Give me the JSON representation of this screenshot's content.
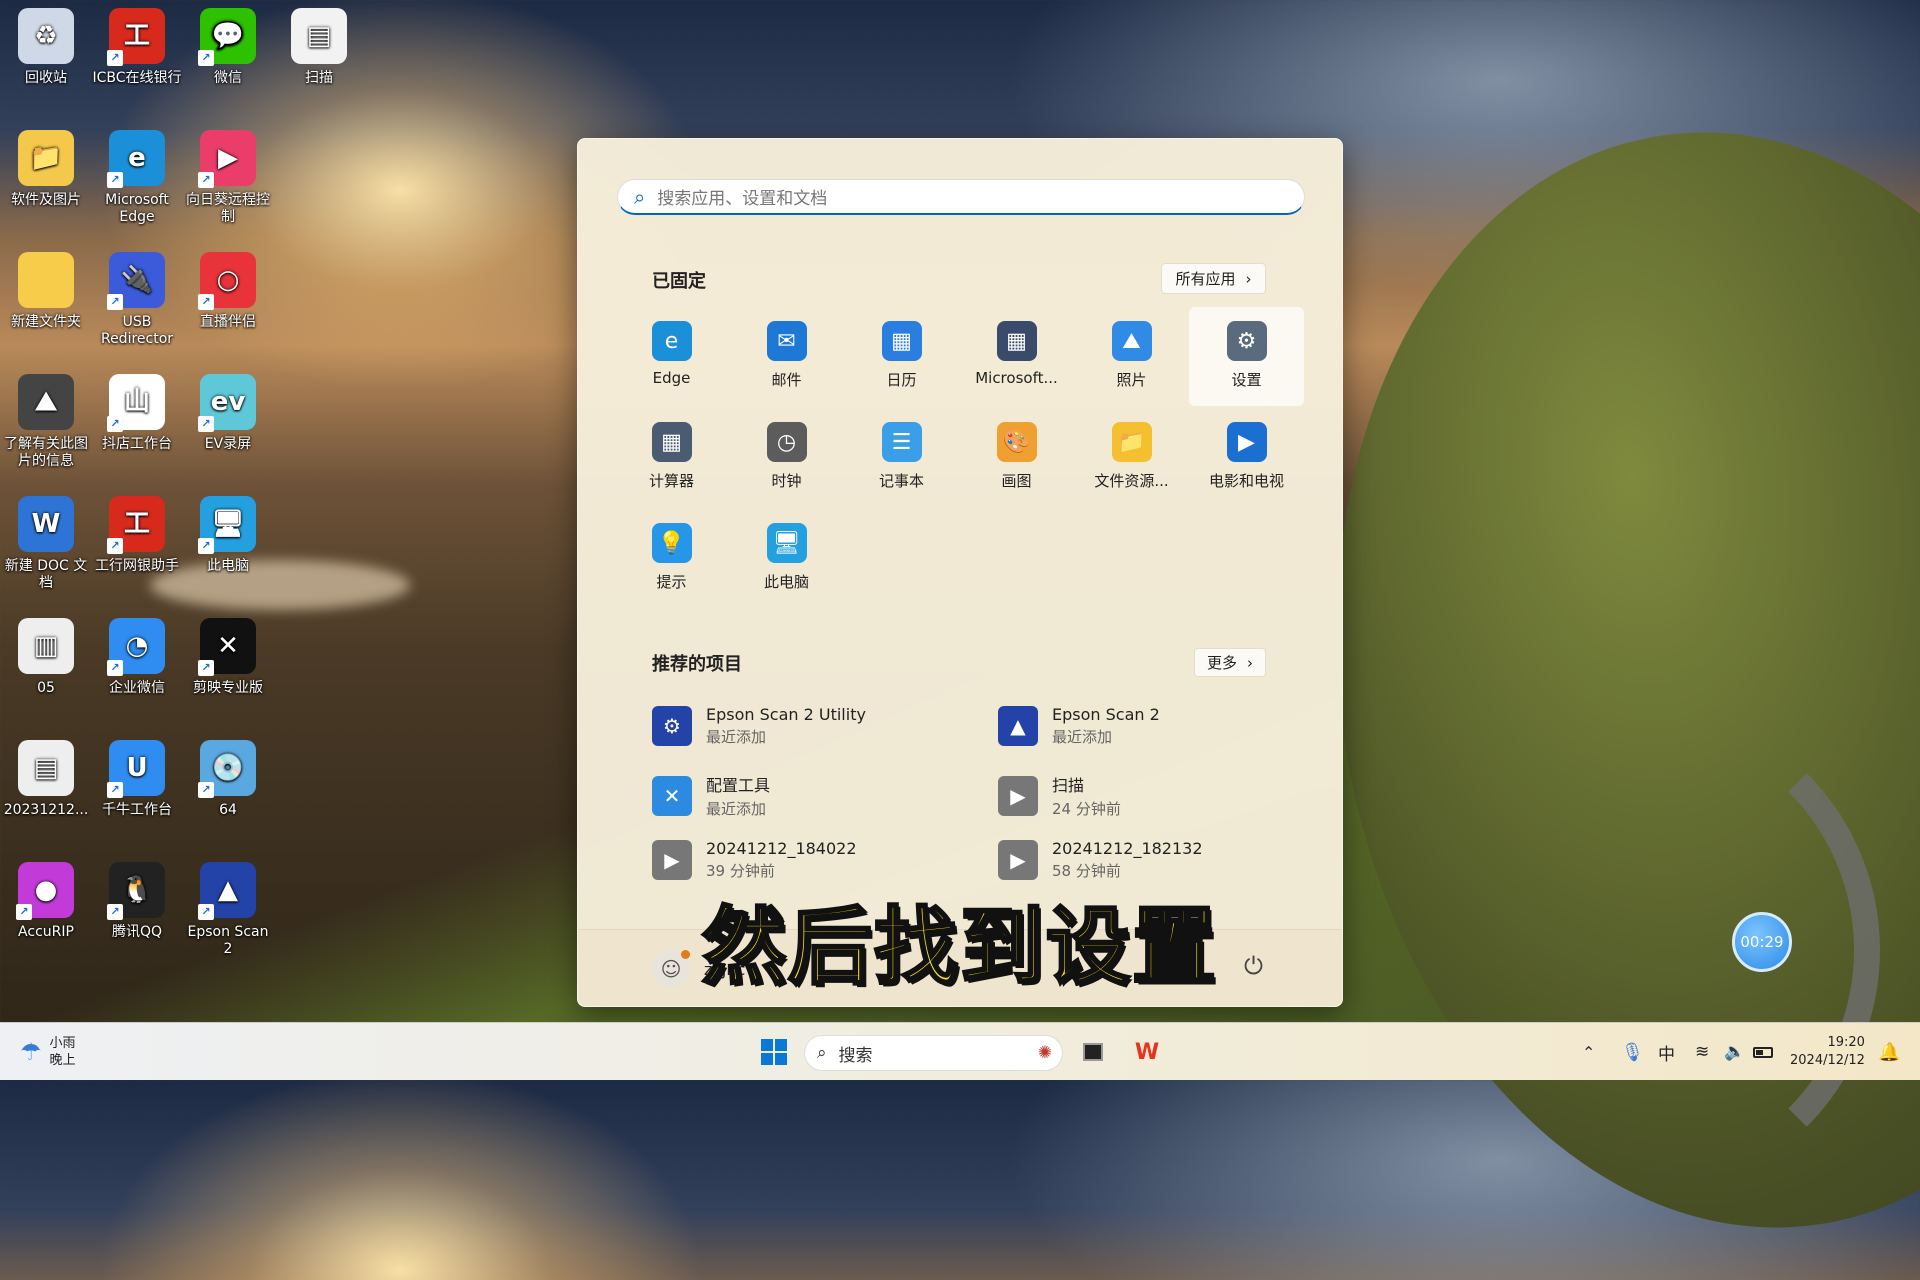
{
  "desktop": {
    "icons": [
      {
        "label": "回收站",
        "glyph": "♻",
        "color": "#cfd8e6"
      },
      {
        "label": "ICBC在线银行",
        "glyph": "工",
        "color": "#d8291d"
      },
      {
        "label": "微信",
        "glyph": "💬",
        "color": "#2dc100"
      },
      {
        "label": "扫描",
        "glyph": "▤",
        "color": "#f2f2f2"
      },
      {
        "label": "软件及图片",
        "glyph": "📁",
        "color": "#f4c84a"
      },
      {
        "label": "Microsoft Edge",
        "glyph": "e",
        "color": "#1b8fd8"
      },
      {
        "label": "向日葵远程控制",
        "glyph": "▶",
        "color": "#ea3d6a"
      },
      {
        "label": "新建文件夹",
        "glyph": "",
        "color": "#f7cc4a"
      },
      {
        "label": "USB Redirector",
        "glyph": "🔌",
        "color": "#3b5bdb"
      },
      {
        "label": "直播伴侣",
        "glyph": "○",
        "color": "#e8333a"
      },
      {
        "label": "了解有关此图片的信息",
        "glyph": "⛰",
        "color": "#444"
      },
      {
        "label": "抖店工作台",
        "glyph": "山",
        "color": "#ffffff"
      },
      {
        "label": "EV录屏",
        "glyph": "ev",
        "color": "#5ec8d8"
      },
      {
        "label": "新建 DOC 文档",
        "glyph": "W",
        "color": "#2e74d6"
      },
      {
        "label": "工行网银助手",
        "glyph": "工",
        "color": "#d8291d"
      },
      {
        "label": "此电脑",
        "glyph": "🖥",
        "color": "#24a0e0"
      },
      {
        "label": "05",
        "glyph": "▥",
        "color": "#eeeeee"
      },
      {
        "label": "企业微信",
        "glyph": "◔",
        "color": "#2f8cf0"
      },
      {
        "label": "剪映专业版",
        "glyph": "✕",
        "color": "#111111"
      },
      {
        "label": "20231212...",
        "glyph": "▤",
        "color": "#eeeeee"
      },
      {
        "label": "千牛工作台",
        "glyph": "U",
        "color": "#2f8cf0"
      },
      {
        "label": "64",
        "glyph": "💿",
        "color": "#5aa8e0"
      },
      {
        "label": "AccuRIP",
        "glyph": "●",
        "color": "#c23bd8"
      },
      {
        "label": "腾讯QQ",
        "glyph": "🐧",
        "color": "#222222"
      },
      {
        "label": "Epson Scan 2",
        "glyph": "▲",
        "color": "#2443a8"
      }
    ]
  },
  "start_menu": {
    "search_placeholder": "搜索应用、设置和文档",
    "pinned_title": "已固定",
    "all_apps": "所有应用",
    "pinned": [
      {
        "label": "Edge",
        "glyph": "e",
        "color": "#1b8fd8"
      },
      {
        "label": "邮件",
        "glyph": "✉",
        "color": "#1e78d6"
      },
      {
        "label": "日历",
        "glyph": "▦",
        "color": "#2a7ee0"
      },
      {
        "label": "Microsoft...",
        "glyph": "▦",
        "color": "#3a4a6a"
      },
      {
        "label": "照片",
        "glyph": "⛰",
        "color": "#2f8be6"
      },
      {
        "label": "设置",
        "glyph": "⚙",
        "color": "#5b6b7e"
      },
      {
        "label": "计算器",
        "glyph": "▦",
        "color": "#4a5b72"
      },
      {
        "label": "时钟",
        "glyph": "◷",
        "color": "#5c5c5c"
      },
      {
        "label": "记事本",
        "glyph": "☰",
        "color": "#3a9ee8"
      },
      {
        "label": "画图",
        "glyph": "🎨",
        "color": "#f0a030"
      },
      {
        "label": "文件资源...",
        "glyph": "📁",
        "color": "#f4c030"
      },
      {
        "label": "电影和电视",
        "glyph": "▶",
        "color": "#1b6fd0"
      },
      {
        "label": "提示",
        "glyph": "💡",
        "color": "#2596e8"
      },
      {
        "label": "此电脑",
        "glyph": "🖥",
        "color": "#24a0e0"
      }
    ],
    "recommended_title": "推荐的项目",
    "more": "更多",
    "recommended": [
      {
        "title": "Epson Scan 2 Utility",
        "sub": "最近添加",
        "glyph": "⚙",
        "color": "#2443a8"
      },
      {
        "title": "Epson Scan 2",
        "sub": "最近添加",
        "glyph": "▲",
        "color": "#2443a8"
      },
      {
        "title": "配置工具",
        "sub": "最近添加",
        "glyph": "✕",
        "color": "#2c8be0"
      },
      {
        "title": "扫描",
        "sub": "24 分钟前",
        "glyph": "▶",
        "color": "#777777"
      },
      {
        "title": "20241212_184022",
        "sub": "39 分钟前",
        "glyph": "▶",
        "color": "#777777"
      },
      {
        "title": "20241212_182132",
        "sub": "58 分钟前",
        "glyph": "▶",
        "color": "#777777"
      }
    ],
    "user": "zxjnc"
  },
  "subtitle": "然后找到设置",
  "timer": "00:29",
  "taskbar": {
    "weather_line1": "小雨",
    "weather_line2": "晚上",
    "search_label": "搜索",
    "ime": "中",
    "time": "19:20",
    "date": "2024/12/12"
  }
}
